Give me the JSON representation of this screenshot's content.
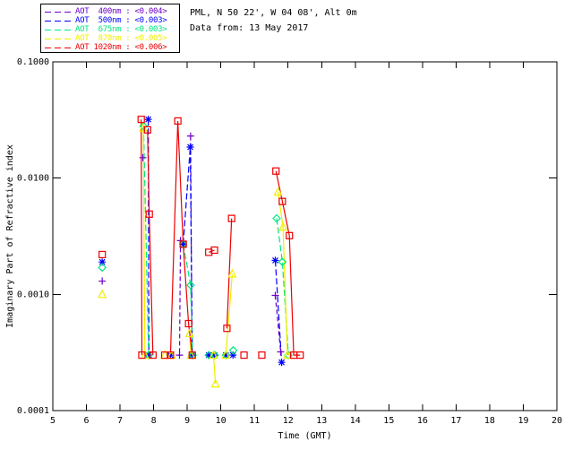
{
  "header": {
    "line1": "PML, N 50 22', W 04 08', Alt 0m",
    "line2": "Data from: 13 May 2017"
  },
  "chart_data": {
    "type": "line",
    "title": "",
    "xlabel": "Time (GMT)",
    "ylabel": "Imaginary Part of Refractive index",
    "xlim": [
      5,
      20
    ],
    "xticks": [
      5,
      6,
      7,
      8,
      9,
      10,
      11,
      12,
      13,
      14,
      15,
      16,
      17,
      18,
      19,
      20
    ],
    "yscale": "log",
    "ylim": [
      0.0001,
      0.1
    ],
    "yticks": [
      {
        "value": 0.1,
        "label": "0.1000"
      },
      {
        "value": 0.01,
        "label": "0.0100"
      },
      {
        "value": 0.001,
        "label": "0.0010"
      },
      {
        "value": 0.0001,
        "label": "0.0001"
      }
    ],
    "grid": false,
    "legend_position": "top-left",
    "baseline_floor": 0.0003,
    "series": [
      {
        "name": "AOT 400nm",
        "legend_label": "AOT  400nm : <0.004>",
        "color": "#6E00C8",
        "marker": "plus",
        "dash": [
          5,
          3
        ],
        "segments": [
          [
            [
              6.47,
              0.0013
            ]
          ],
          [
            [
              7.68,
              0.015
            ]
          ],
          [
            [
              8.8,
              0.0029
            ],
            [
              8.77,
              0.0003
            ]
          ],
          [
            [
              9.1,
              0.023
            ],
            [
              9.14,
              0.0003
            ]
          ],
          [
            [
              11.62,
              0.00098
            ],
            [
              11.78,
              0.00032
            ]
          ]
        ]
      },
      {
        "name": "AOT 500nm",
        "legend_label": "AOT  500nm : <0.003>",
        "color": "#0000FF",
        "marker": "asterisk",
        "dash": [
          7,
          3
        ],
        "segments": [
          [
            [
              6.47,
              0.0019
            ]
          ],
          [
            [
              7.84,
              0.032
            ],
            [
              7.86,
              0.0003
            ]
          ],
          [
            [
              8.5,
              0.0003
            ]
          ],
          [
            [
              8.88,
              0.0027
            ],
            [
              9.09,
              0.0185
            ],
            [
              9.15,
              0.0003
            ]
          ],
          [
            [
              9.64,
              0.0003
            ]
          ],
          [
            [
              9.81,
              0.0003
            ]
          ],
          [
            [
              10.15,
              0.0003
            ]
          ],
          [
            [
              10.36,
              0.0003
            ]
          ],
          [
            [
              11.62,
              0.00196
            ],
            [
              11.81,
              0.00026
            ]
          ]
        ]
      },
      {
        "name": "AOT 675nm",
        "legend_label": "AOT  675nm : <0.003>",
        "color": "#00E87C",
        "marker": "diamond",
        "dash": [
          7,
          3
        ],
        "segments": [
          [
            [
              6.47,
              0.0017
            ]
          ],
          [
            [
              7.7,
              0.028
            ],
            [
              7.85,
              0.0003
            ]
          ],
          [
            [
              8.88,
              0.0027
            ],
            [
              9.1,
              0.0012
            ],
            [
              9.16,
              0.0003
            ]
          ],
          [
            [
              9.64,
              0.0003
            ]
          ],
          [
            [
              9.82,
              0.0003
            ]
          ],
          [
            [
              10.15,
              0.0003
            ]
          ],
          [
            [
              10.37,
              0.00033
            ]
          ],
          [
            [
              11.66,
              0.0045
            ],
            [
              11.83,
              0.0019
            ],
            [
              12.01,
              0.0003
            ]
          ]
        ]
      },
      {
        "name": "AOT 870nm",
        "legend_label": "AOT  870nm : <0.005>",
        "color": "#EFEF00",
        "marker": "triangle",
        "dash": null,
        "segments": [
          [
            [
              6.47,
              0.001
            ]
          ],
          [
            [
              7.69,
              0.027
            ],
            [
              7.74,
              0.0003
            ]
          ],
          [
            [
              8.33,
              0.0003
            ]
          ],
          [
            [
              8.53,
              0.0003
            ]
          ],
          [
            [
              9.07,
              0.00046
            ],
            [
              9.11,
              0.0003
            ]
          ],
          [
            [
              9.78,
              0.0003
            ],
            [
              9.84,
              0.00017
            ]
          ],
          [
            [
              10.15,
              0.0003
            ],
            [
              10.34,
              0.0015
            ]
          ],
          [
            [
              11.7,
              0.0076
            ],
            [
              11.85,
              0.0038
            ],
            [
              11.98,
              0.0003
            ]
          ]
        ]
      },
      {
        "name": "AOT 1020nm",
        "legend_label": "AOT 1020nm : <0.006>",
        "color": "#EE0000",
        "marker": "square",
        "dash": null,
        "segments": [
          [
            [
              6.47,
              0.0022
            ]
          ],
          [
            [
              7.63,
              0.032
            ],
            [
              7.65,
              0.0003
            ]
          ],
          [
            [
              7.82,
              0.026
            ],
            [
              7.87,
              0.0049
            ],
            [
              7.98,
              0.0003
            ]
          ],
          [
            [
              8.33,
              0.0003
            ]
          ],
          [
            [
              8.5,
              0.0003
            ],
            [
              8.72,
              0.031
            ],
            [
              8.88,
              0.0027
            ],
            [
              9.04,
              0.00056
            ],
            [
              9.15,
              0.0003
            ]
          ],
          [
            [
              9.64,
              0.0023
            ],
            [
              9.81,
              0.0024
            ]
          ],
          [
            [
              10.18,
              0.00051
            ],
            [
              10.32,
              0.0045
            ]
          ],
          [
            [
              10.69,
              0.0003
            ]
          ],
          [
            [
              11.22,
              0.0003
            ]
          ],
          [
            [
              11.64,
              0.0115
            ],
            [
              11.83,
              0.0063
            ],
            [
              12.04,
              0.0032
            ],
            [
              12.17,
              0.0003
            ],
            [
              12.36,
              0.0003
            ]
          ]
        ]
      }
    ]
  }
}
